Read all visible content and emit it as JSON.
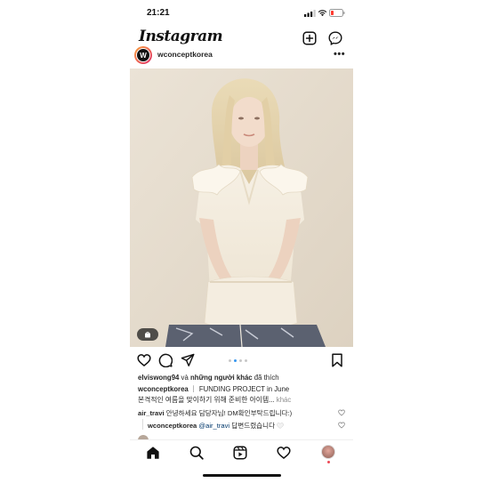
{
  "status_bar": {
    "time": "21:21"
  },
  "header": {
    "logo": "Instagram",
    "icons": [
      "new-post-icon",
      "messenger-icon"
    ]
  },
  "post": {
    "username": "wconceptkorea",
    "avatar_letter": "W",
    "more_options": "•••",
    "carousel": {
      "dots": 4,
      "active_index": 1
    },
    "likes": {
      "user": "elviswong94",
      "connector": " và ",
      "others": "những người khác",
      "suffix": " đã thích"
    },
    "caption": {
      "username": "wconceptkorea",
      "text": " ｜ FUNDING PROJECT in June",
      "line2": "본격적인 여름을 맞이하기 위해 준비한 아이템...",
      "more": " khác"
    },
    "comments": [
      {
        "username": "air_travi",
        "text": " 안녕하세요 담당자님! DM확인부탁드립니다:)"
      },
      {
        "username": "wconceptkorea",
        "mention": " @air_travi",
        "text": " 답변드렸습니다"
      }
    ]
  },
  "bottom_nav": {
    "items": [
      "home-icon",
      "search-icon",
      "reels-icon",
      "activity-icon",
      "profile-avatar"
    ]
  },
  "colors": {
    "link": "#00376b",
    "muted": "#8e8e8e",
    "active_dot": "#3897f0",
    "notification": "#ed4956"
  }
}
